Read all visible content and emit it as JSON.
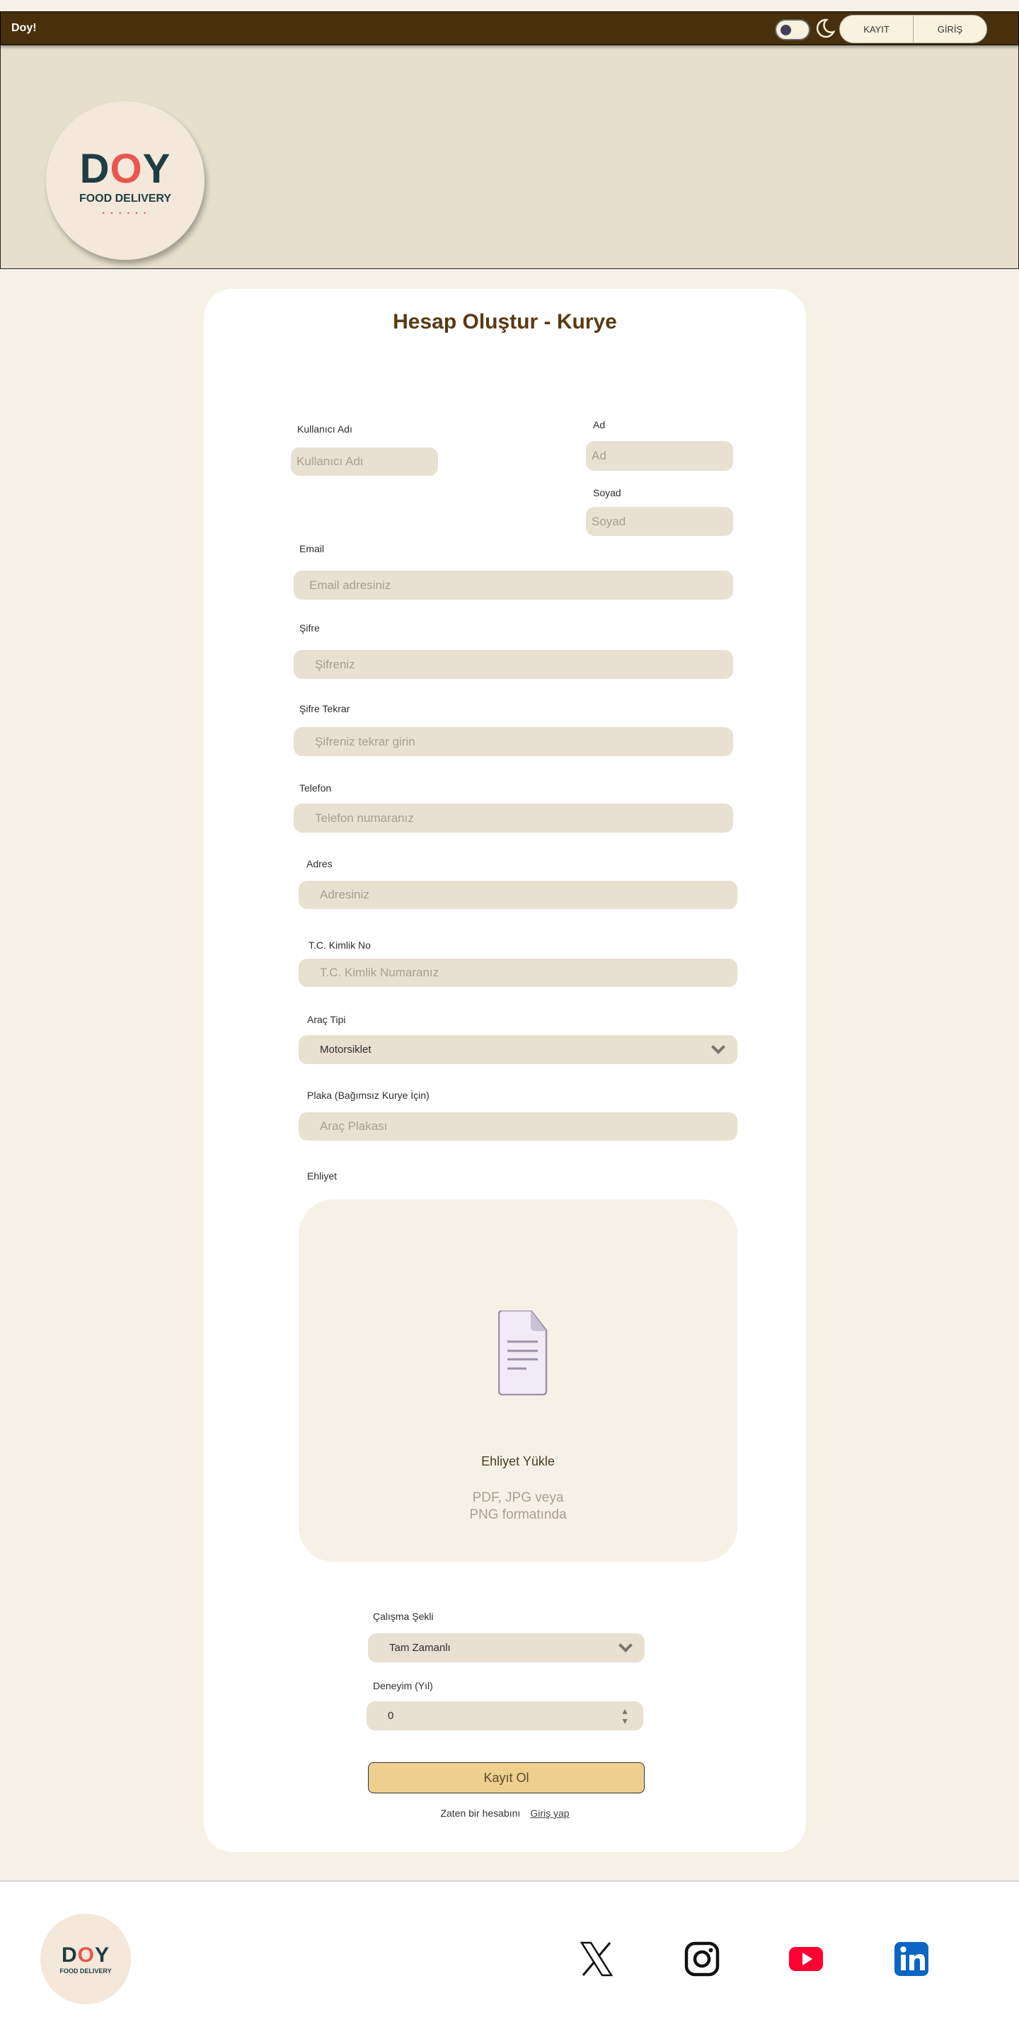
{
  "header": {
    "brand": "Doy!",
    "register": "KAYIT",
    "login": "GİRİŞ",
    "theme_toggle_icon": "moon-icon"
  },
  "logo": {
    "text_d": "D",
    "text_o": "O",
    "text_y": "Y",
    "tagline": "FOOD DELIVERY",
    "dots": "• • •  • • •"
  },
  "form": {
    "title": "Hesap Oluştur - Kurye",
    "username": {
      "label": "Kullanıcı Adı",
      "placeholder": "Kullanıcı Adı"
    },
    "first_name": {
      "label": "Ad",
      "placeholder": "Ad"
    },
    "last_name": {
      "label": "Soyad",
      "placeholder": "Soyad"
    },
    "email": {
      "label": "Email",
      "placeholder": "Email adresiniz"
    },
    "password": {
      "label": "Şifre",
      "placeholder": "Şifreniz"
    },
    "password_repeat": {
      "label": "Şifre Tekrar",
      "placeholder": "Şifreniz tekrar girin"
    },
    "phone": {
      "label": "Telefon",
      "placeholder": "Telefon numaranız"
    },
    "address": {
      "label": "Adres",
      "placeholder": "Adresiniz"
    },
    "tc": {
      "label": "T.C. Kimlik No",
      "placeholder": "T.C. Kimlik Numaranız"
    },
    "vehicle_type": {
      "label": "Araç Tipi",
      "value": "Motorsiklet"
    },
    "plate": {
      "label": "Plaka (Bağımsız Kurye İçin)",
      "placeholder": "Araç Plakası"
    },
    "license": {
      "label": "Ehliyet",
      "upload_title": "Ehliyet Yükle",
      "upload_hint_1": "PDF, JPG veya",
      "upload_hint_2": "PNG formatında"
    },
    "work_type": {
      "label": "Çalışma Şekli",
      "value": "Tam Zamanlı"
    },
    "experience": {
      "label": "Deneyim (Yıl)",
      "value": "0"
    },
    "submit": "Kayıt Ol",
    "already_text": "Zaten bir hesabını",
    "login_link": "Giriş yap"
  },
  "footer": {
    "socials": [
      "x-icon",
      "instagram-icon",
      "youtube-icon",
      "linkedin-icon"
    ],
    "colors": {
      "youtube": "#ff0033",
      "linkedin": "#0a66c2"
    }
  }
}
